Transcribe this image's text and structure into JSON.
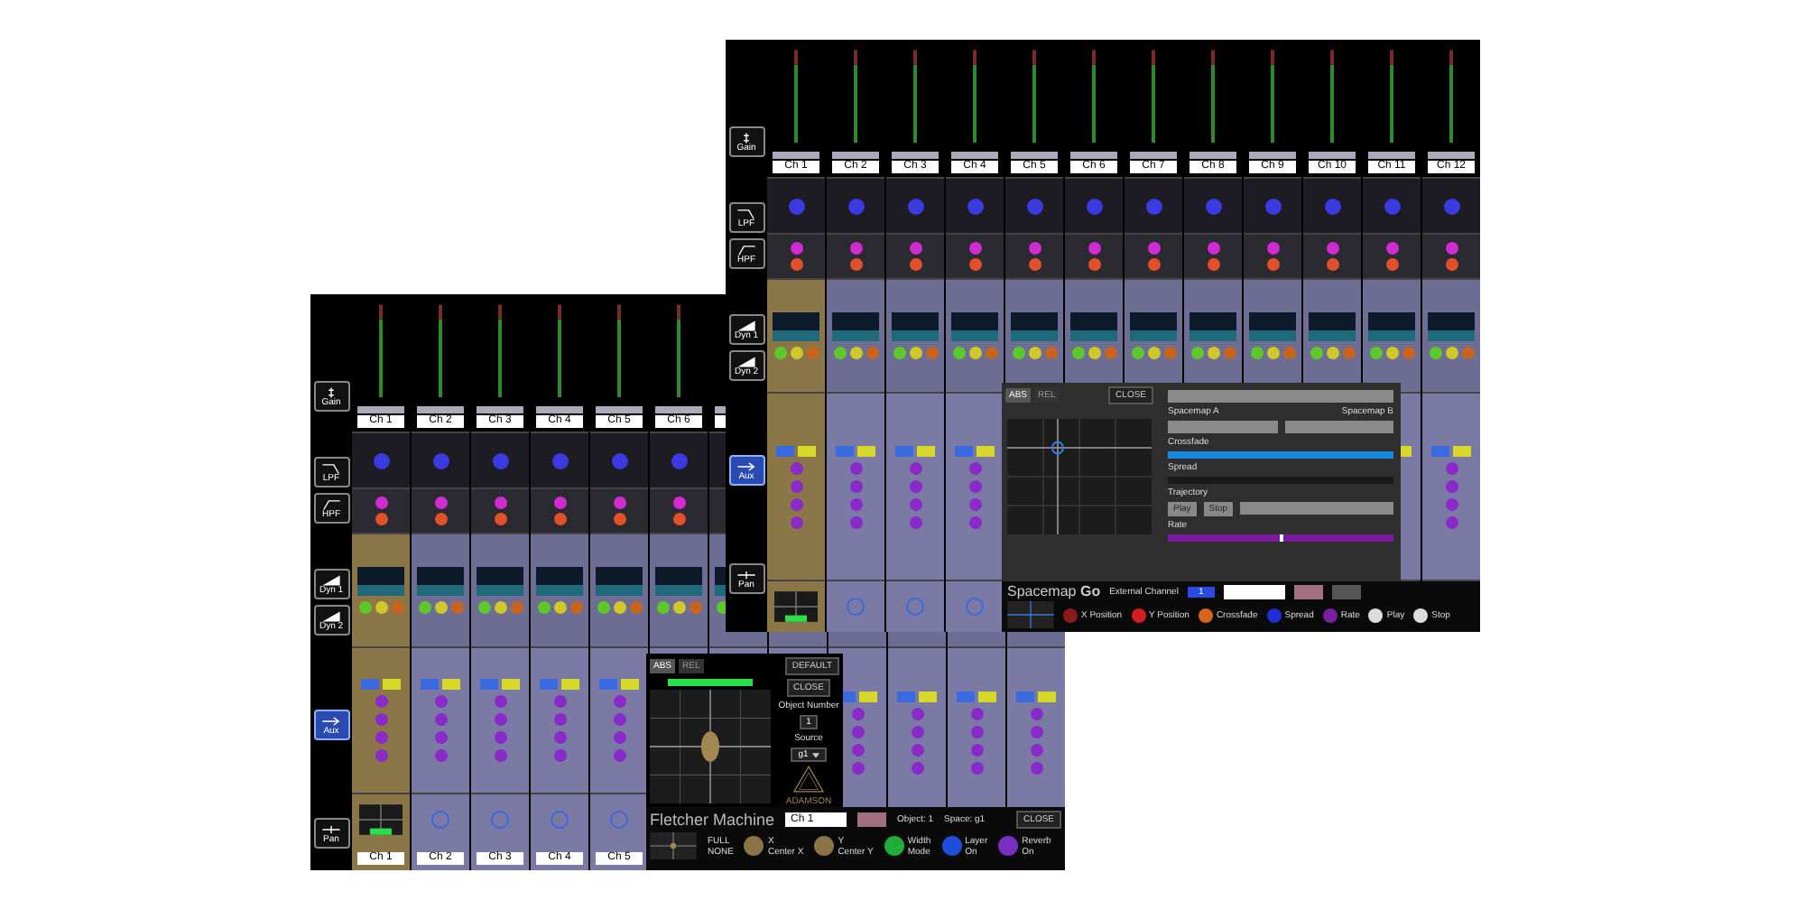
{
  "windows": [
    {
      "sidebar": [
        {
          "kind": "gain",
          "label": "Gain",
          "selected": false
        },
        {
          "kind": "lpf",
          "label": "LPF",
          "selected": false
        },
        {
          "kind": "hpf",
          "label": "HPF",
          "selected": false
        },
        {
          "kind": "dyn",
          "label": "Dyn 1",
          "selected": false
        },
        {
          "kind": "dyn",
          "label": "Dyn 2",
          "selected": false
        },
        {
          "kind": "aux",
          "label": "Aux",
          "selected": true
        },
        {
          "kind": "pan",
          "label": "Pan",
          "selected": false
        }
      ],
      "strips": [
        {
          "name": "Ch 1",
          "bottom_name": "Ch 1",
          "selected": true
        },
        {
          "name": "Ch 2",
          "bottom_name": "Ch 2",
          "selected": false
        },
        {
          "name": "Ch 3",
          "bottom_name": "Ch 3",
          "selected": false
        },
        {
          "name": "Ch 4",
          "bottom_name": "Ch 4",
          "selected": false
        },
        {
          "name": "Ch 5",
          "bottom_name": "Ch 5",
          "selected": false
        },
        {
          "name": "Ch 6",
          "selected": false
        },
        {
          "selected": false
        },
        {
          "selected": false
        },
        {
          "selected": false
        },
        {
          "selected": false
        },
        {
          "selected": false
        },
        {
          "selected": false
        }
      ],
      "panel": {
        "kind": "fletcher",
        "tabs": [
          {
            "label": "ABS",
            "selected": true
          },
          {
            "label": "REL",
            "selected": false
          }
        ],
        "default_button": "DEFAULT",
        "close_button": "CLOSE",
        "object_label": "Object Number",
        "object_value": "1",
        "source_label": "Source",
        "source_value": "g1",
        "logo": "ADAMSON",
        "brand": "Fletcher Machine",
        "channel_field": "Ch 1",
        "object_status": "Object: 1",
        "space_status": "Space: g1",
        "bottom_close": "CLOSE",
        "modes": [
          "FULL",
          "NONE"
        ],
        "knobs": [
          {
            "label": "X",
            "color": "#8a7446",
            "toggle": "Center X"
          },
          {
            "label": "Y",
            "color": "#8a7446",
            "toggle": "Center Y"
          },
          {
            "label": "Width",
            "color": "#1fae3a",
            "toggle": "Mode"
          },
          {
            "label": "Layer",
            "color": "#1f4fd8",
            "toggle": "On"
          },
          {
            "label": "Reverb",
            "color": "#7a2fc0",
            "toggle": "On"
          }
        ]
      }
    },
    {
      "sidebar": [
        {
          "kind": "gain",
          "label": "Gain",
          "selected": false
        },
        {
          "kind": "lpf",
          "label": "LPF",
          "selected": false
        },
        {
          "kind": "hpf",
          "label": "HPF",
          "selected": false
        },
        {
          "kind": "dyn",
          "label": "Dyn 1",
          "selected": false
        },
        {
          "kind": "dyn",
          "label": "Dyn 2",
          "selected": false
        },
        {
          "kind": "aux",
          "label": "Aux",
          "selected": true
        },
        {
          "kind": "pan",
          "label": "Pan",
          "selected": false
        }
      ],
      "strips": [
        {
          "name": "Ch 1",
          "selected": true
        },
        {
          "name": "Ch 2",
          "selected": false
        },
        {
          "name": "Ch 3",
          "selected": false
        },
        {
          "name": "Ch 4",
          "selected": false
        },
        {
          "name": "Ch 5",
          "selected": false
        },
        {
          "name": "Ch 6",
          "selected": false
        },
        {
          "name": "Ch 7",
          "selected": false
        },
        {
          "name": "Ch 8",
          "selected": false
        },
        {
          "name": "Ch 9",
          "selected": false
        },
        {
          "name": "Ch 10",
          "selected": false
        },
        {
          "name": "Ch 11",
          "selected": false
        },
        {
          "name": "Ch 12",
          "selected": false
        }
      ],
      "panel": {
        "kind": "spacemap",
        "tabs": [
          {
            "label": "ABS",
            "selected": true
          },
          {
            "label": "REL",
            "selected": false
          }
        ],
        "close_button": "CLOSE",
        "spacemap_a": "Spacemap A",
        "spacemap_b": "Spacemap B",
        "crossfade": {
          "label": "Crossfade",
          "level": 1
        },
        "spread": {
          "label": "Spread",
          "level": 0
        },
        "trajectory": "Trajectory",
        "play_button": "Play",
        "stop_button": "Stop",
        "rate": {
          "label": "Rate",
          "level": 0.5
        },
        "title_light": "Spacemap",
        "title_bold": "Go",
        "external_label": "External Channel",
        "external_value": "1",
        "knobs": [
          {
            "label": "X Position",
            "color": "#8a1a1a"
          },
          {
            "label": "Y Position",
            "color": "#d41f1f"
          },
          {
            "label": "Crossfade",
            "color": "#d8661a"
          },
          {
            "label": "Spread",
            "color": "#1f2fd8"
          },
          {
            "label": "Rate",
            "color": "#7a1fa0"
          },
          {
            "label": "Play",
            "color": "#dddddd"
          },
          {
            "label": "Stop",
            "color": "#dddddd"
          }
        ]
      }
    }
  ]
}
